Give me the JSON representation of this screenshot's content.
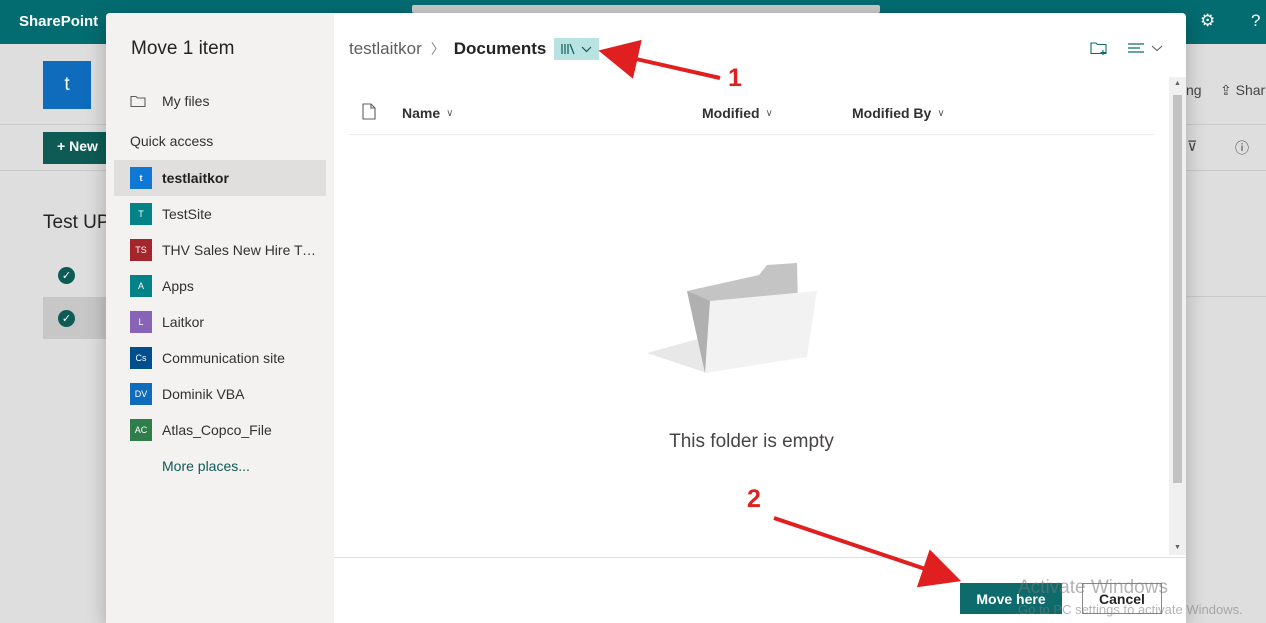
{
  "suite": {
    "brand": "SharePoint"
  },
  "background": {
    "site_initial": "t",
    "new_label": "New",
    "list_title": "Test UP",
    "right_items": [
      "ng",
      "Shar"
    ]
  },
  "dialog": {
    "title": "Move 1 item",
    "my_files": "My files",
    "quick_access_label": "Quick access",
    "sites": [
      {
        "initials": "t",
        "label": "testlaitkor",
        "color": "#0f78d4"
      },
      {
        "initials": "T",
        "label": "TestSite",
        "color": "#038387"
      },
      {
        "initials": "TS",
        "label": "THV Sales New Hire Tra...",
        "color": "#a4262c"
      },
      {
        "initials": "A",
        "label": "Apps",
        "color": "#038387"
      },
      {
        "initials": "L",
        "label": "Laitkor",
        "color": "#8764b8"
      },
      {
        "initials": "Cs",
        "label": "Communication site",
        "color": "#004e8c"
      },
      {
        "initials": "DV",
        "label": "Dominik VBA",
        "color": "#0f6cbd"
      },
      {
        "initials": "AC",
        "label": "Atlas_Copco_File",
        "color": "#2e7d4a"
      }
    ],
    "more_places": "More places...",
    "breadcrumb": {
      "site": "testlaitkor",
      "library": "Documents"
    },
    "columns": {
      "name": "Name",
      "modified": "Modified",
      "modified_by": "Modified By"
    },
    "empty_message": "This folder is empty",
    "buttons": {
      "move_here": "Move here",
      "cancel": "Cancel"
    }
  },
  "annotations": {
    "step1": "1",
    "step2": "2"
  },
  "watermark": {
    "title": "Activate Windows",
    "subtitle": "Go to PC settings to activate Windows."
  },
  "colors": {
    "accent": "#0e6b6b",
    "annotation": "#e02020",
    "suite_bar": "#036c70"
  }
}
